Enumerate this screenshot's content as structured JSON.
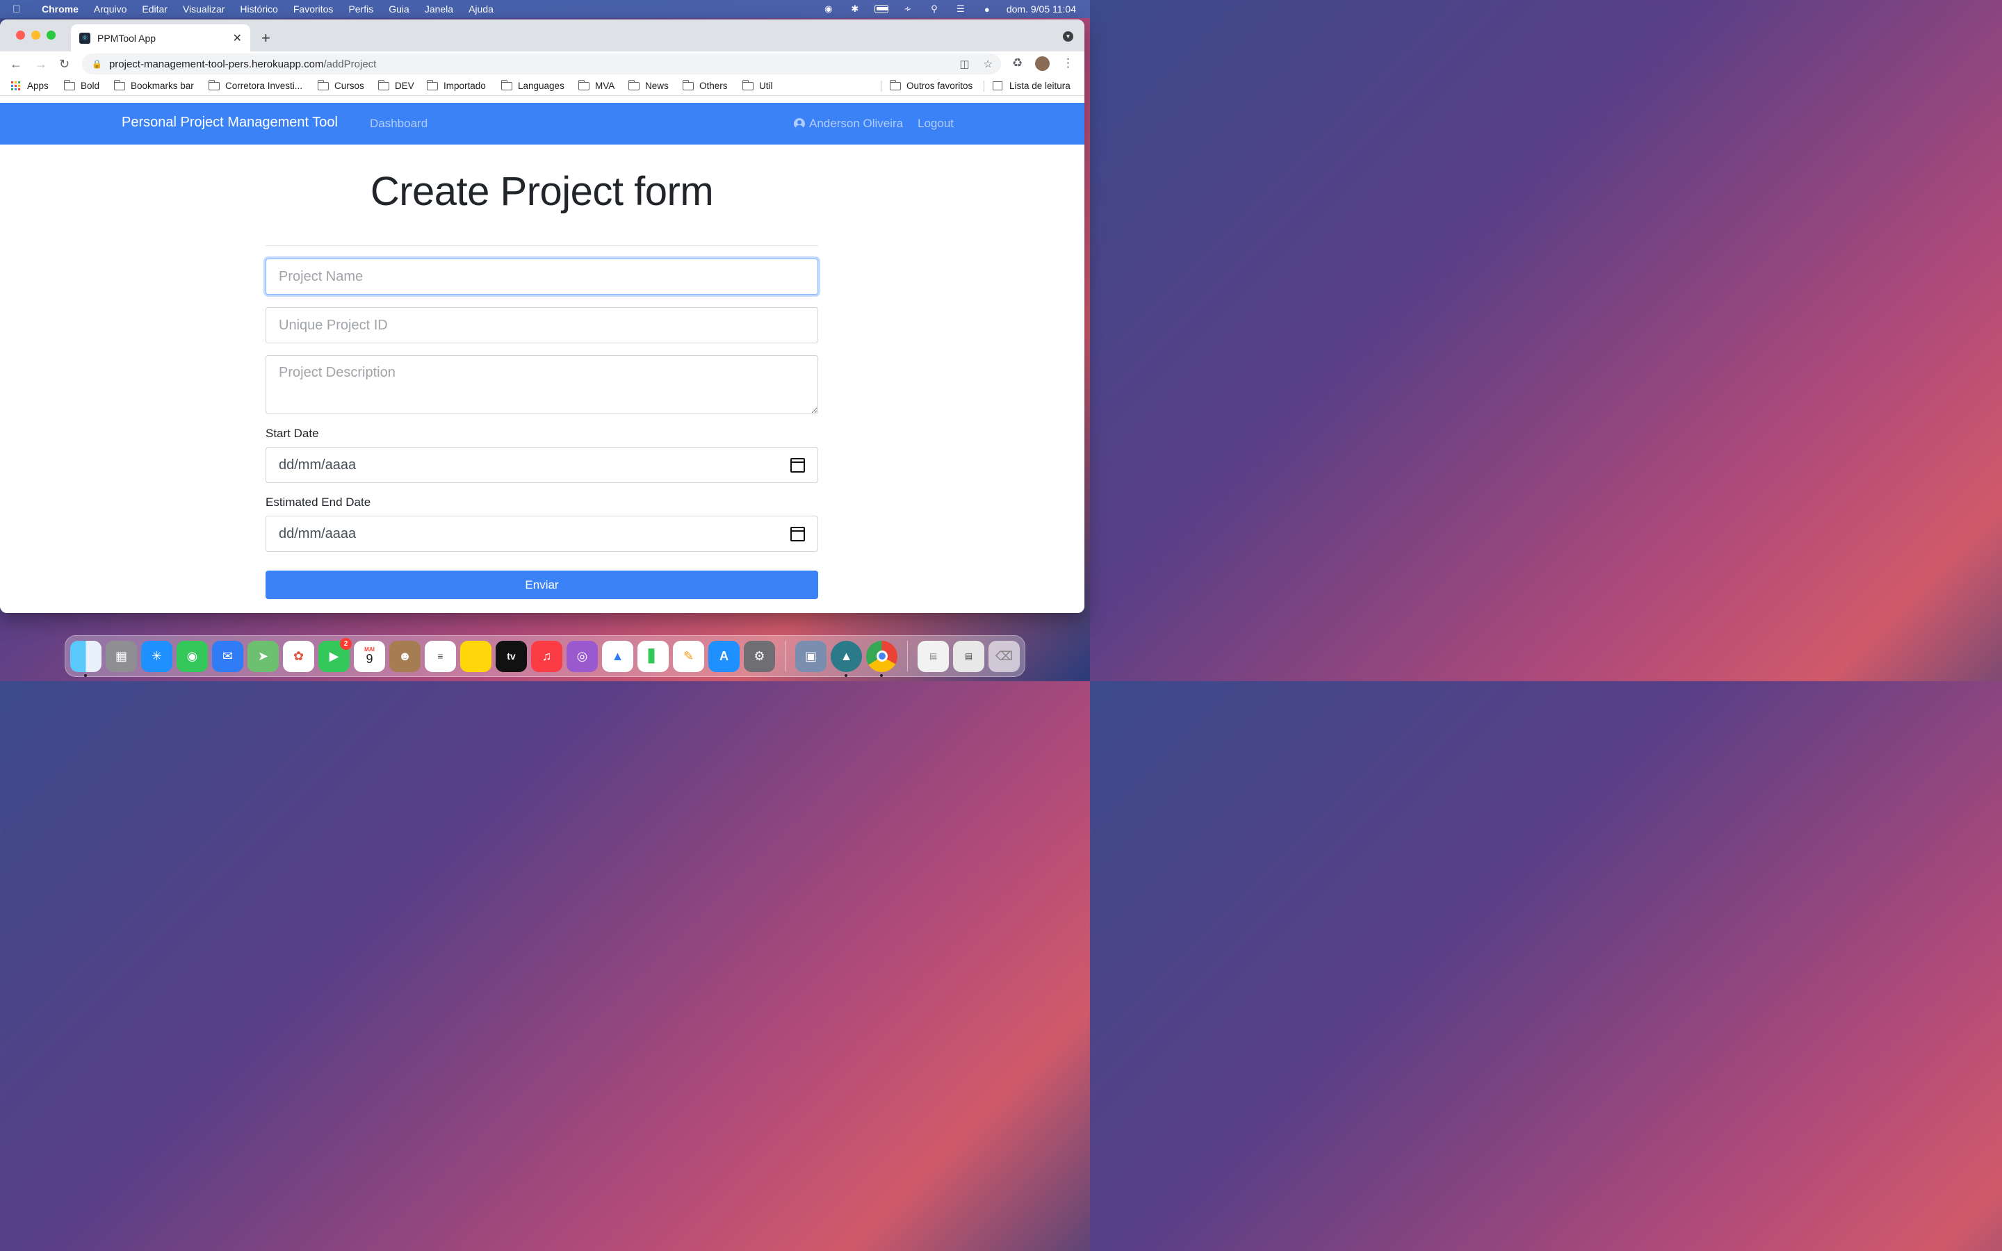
{
  "menubar": {
    "app": "Chrome",
    "menus": [
      "Arquivo",
      "Editar",
      "Visualizar",
      "Histórico",
      "Favoritos",
      "Perfis",
      "Guia",
      "Janela",
      "Ajuda"
    ],
    "datetime": "dom. 9/05  11:04"
  },
  "browser": {
    "tab_title": "PPMTool App",
    "url_host": "project-management-tool-pers.herokuapp.com",
    "url_path": "/addProject",
    "bookmarks": [
      "Apps",
      "Bold",
      "Bookmarks bar",
      "Corretora Investi...",
      "Cursos",
      "DEV",
      "Importado",
      "Languages",
      "MVA",
      "News",
      "Others",
      "Util"
    ],
    "other_bookmarks": "Outros favoritos",
    "reading_list": "Lista de leitura"
  },
  "navbar": {
    "brand": "Personal Project Management Tool",
    "dashboard": "Dashboard",
    "user": "Anderson Oliveira",
    "logout": "Logout"
  },
  "form": {
    "title": "Create Project form",
    "project_name_placeholder": "Project Name",
    "project_id_placeholder": "Unique Project ID",
    "description_placeholder": "Project Description",
    "start_date_label": "Start Date",
    "start_date_value": "dd/mm/aaaa",
    "end_date_label": "Estimated End Date",
    "end_date_value": "dd/mm/aaaa",
    "submit_label": "Enviar"
  },
  "dock": {
    "facetime_badge": "2",
    "calendar_month": "MAI",
    "calendar_day": "9",
    "tv_label": "tv"
  },
  "colors": {
    "navbar": "#3b82f6",
    "button": "#3b82f6"
  }
}
